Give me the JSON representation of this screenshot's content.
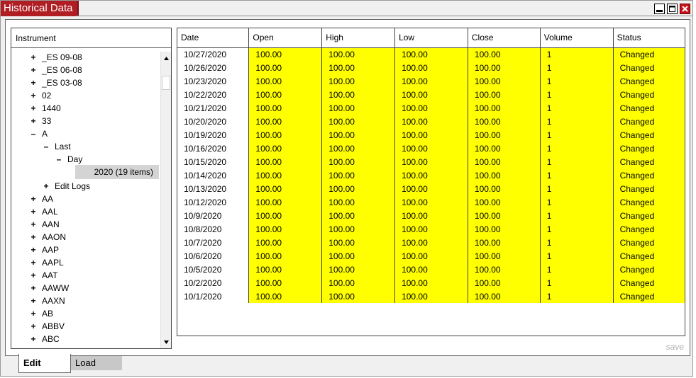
{
  "window": {
    "title": "Historical Data",
    "buttons": {
      "minimize": "minimize-icon",
      "maximize": "maximize-icon",
      "close": "close-icon"
    }
  },
  "instrument_panel": {
    "header": "Instrument",
    "tree": [
      {
        "sign": "+",
        "label": "_ES 09-08",
        "level": 0
      },
      {
        "sign": "+",
        "label": "_ES 06-08",
        "level": 0
      },
      {
        "sign": "+",
        "label": "_ES 03-08",
        "level": 0
      },
      {
        "sign": "+",
        "label": "02",
        "level": 0
      },
      {
        "sign": "+",
        "label": "1440",
        "level": 0
      },
      {
        "sign": "+",
        "label": "33",
        "level": 0
      },
      {
        "sign": "–",
        "label": "A",
        "level": 0
      },
      {
        "sign": "–",
        "label": "Last",
        "level": 1
      },
      {
        "sign": "–",
        "label": "Day",
        "level": 2
      },
      {
        "sign": "",
        "label": "2020 (19 items)",
        "level": 3,
        "selected": true
      },
      {
        "sign": "+",
        "label": "Edit Logs",
        "level": 1
      },
      {
        "sign": "+",
        "label": "AA",
        "level": 0
      },
      {
        "sign": "+",
        "label": "AAL",
        "level": 0
      },
      {
        "sign": "+",
        "label": "AAN",
        "level": 0
      },
      {
        "sign": "+",
        "label": "AAON",
        "level": 0
      },
      {
        "sign": "+",
        "label": "AAP",
        "level": 0
      },
      {
        "sign": "+",
        "label": "AAPL",
        "level": 0
      },
      {
        "sign": "+",
        "label": "AAT",
        "level": 0
      },
      {
        "sign": "+",
        "label": "AAWW",
        "level": 0
      },
      {
        "sign": "+",
        "label": "AAXN",
        "level": 0
      },
      {
        "sign": "+",
        "label": "AB",
        "level": 0
      },
      {
        "sign": "+",
        "label": "ABBV",
        "level": 0
      },
      {
        "sign": "+",
        "label": "ABC",
        "level": 0
      }
    ]
  },
  "table": {
    "columns": [
      "Date",
      "Open",
      "High",
      "Low",
      "Close",
      "Volume",
      "Status"
    ],
    "rows": [
      [
        "10/27/2020",
        "100.00",
        "100.00",
        "100.00",
        "100.00",
        "1",
        "Changed"
      ],
      [
        "10/26/2020",
        "100.00",
        "100.00",
        "100.00",
        "100.00",
        "1",
        "Changed"
      ],
      [
        "10/23/2020",
        "100.00",
        "100.00",
        "100.00",
        "100.00",
        "1",
        "Changed"
      ],
      [
        "10/22/2020",
        "100.00",
        "100.00",
        "100.00",
        "100.00",
        "1",
        "Changed"
      ],
      [
        "10/21/2020",
        "100.00",
        "100.00",
        "100.00",
        "100.00",
        "1",
        "Changed"
      ],
      [
        "10/20/2020",
        "100.00",
        "100.00",
        "100.00",
        "100.00",
        "1",
        "Changed"
      ],
      [
        "10/19/2020",
        "100.00",
        "100.00",
        "100.00",
        "100.00",
        "1",
        "Changed"
      ],
      [
        "10/16/2020",
        "100.00",
        "100.00",
        "100.00",
        "100.00",
        "1",
        "Changed"
      ],
      [
        "10/15/2020",
        "100.00",
        "100.00",
        "100.00",
        "100.00",
        "1",
        "Changed"
      ],
      [
        "10/14/2020",
        "100.00",
        "100.00",
        "100.00",
        "100.00",
        "1",
        "Changed"
      ],
      [
        "10/13/2020",
        "100.00",
        "100.00",
        "100.00",
        "100.00",
        "1",
        "Changed"
      ],
      [
        "10/12/2020",
        "100.00",
        "100.00",
        "100.00",
        "100.00",
        "1",
        "Changed"
      ],
      [
        "10/9/2020",
        "100.00",
        "100.00",
        "100.00",
        "100.00",
        "1",
        "Changed"
      ],
      [
        "10/8/2020",
        "100.00",
        "100.00",
        "100.00",
        "100.00",
        "1",
        "Changed"
      ],
      [
        "10/7/2020",
        "100.00",
        "100.00",
        "100.00",
        "100.00",
        "1",
        "Changed"
      ],
      [
        "10/6/2020",
        "100.00",
        "100.00",
        "100.00",
        "100.00",
        "1",
        "Changed"
      ],
      [
        "10/5/2020",
        "100.00",
        "100.00",
        "100.00",
        "100.00",
        "1",
        "Changed"
      ],
      [
        "10/2/2020",
        "100.00",
        "100.00",
        "100.00",
        "100.00",
        "1",
        "Changed"
      ],
      [
        "10/1/2020",
        "100.00",
        "100.00",
        "100.00",
        "100.00",
        "1",
        "Changed"
      ]
    ],
    "highlight_color": "#ffff00"
  },
  "save_label": "save",
  "tabs": [
    {
      "label": "Edit",
      "active": true
    },
    {
      "label": "Load",
      "active": false
    }
  ],
  "colors": {
    "title_bar": "#b01d22",
    "changed_row": "#ffff00"
  }
}
